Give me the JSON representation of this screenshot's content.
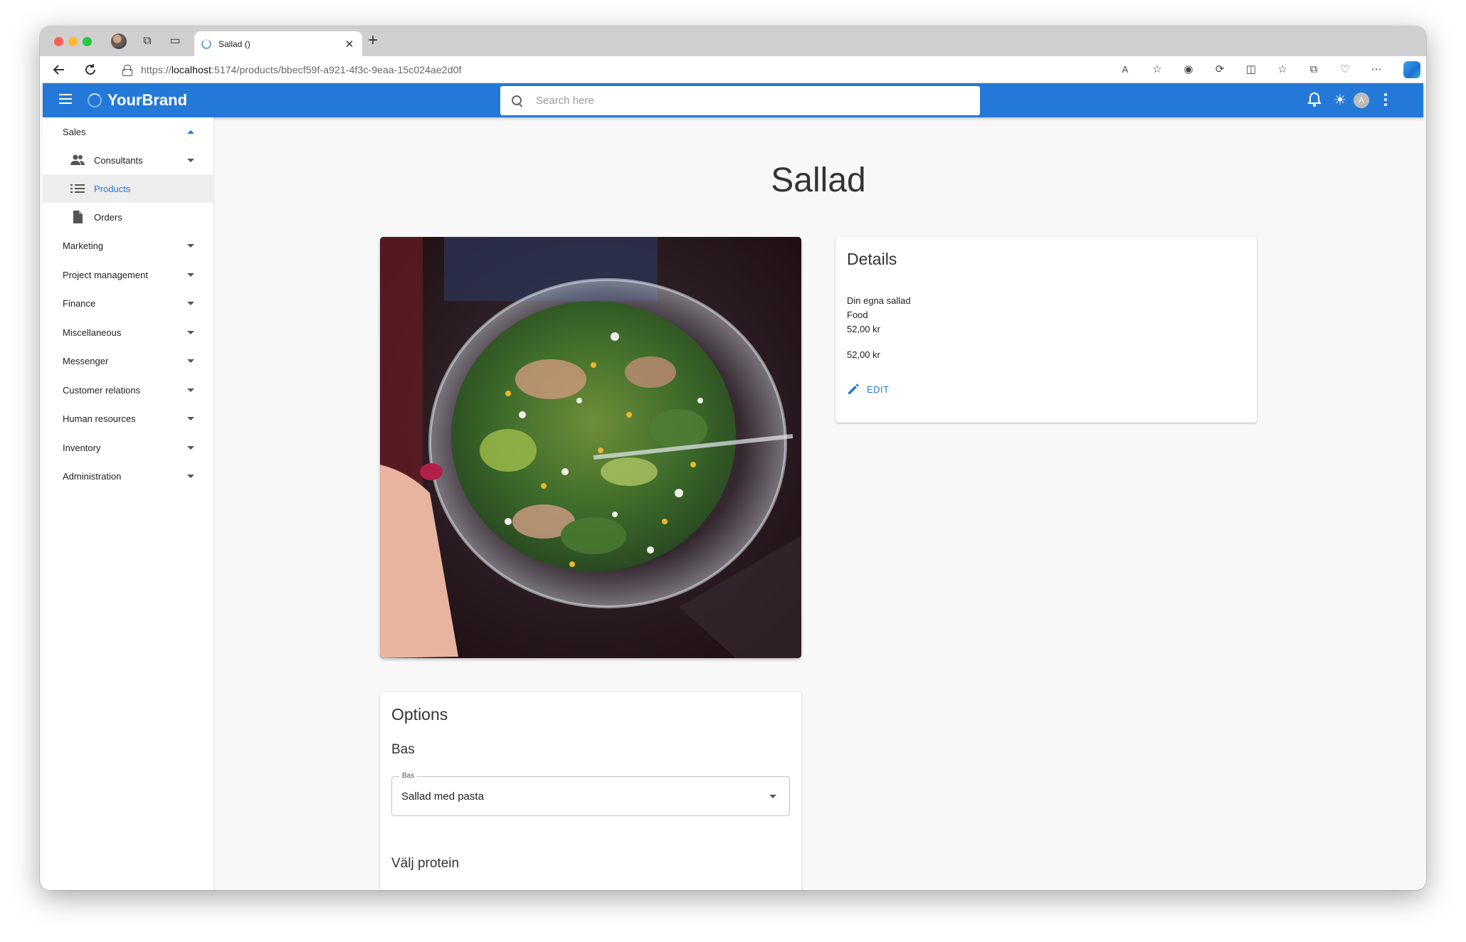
{
  "browser": {
    "tab_title": "Sallad ()",
    "url_prefix": "https://",
    "url_host": "localhost",
    "url_rest": ":5174/products/bbecf59f-a921-4f3c-9eaa-15c024ae2d0f"
  },
  "appbar": {
    "brand": "YourBrand",
    "search_placeholder": "Search here",
    "avatar_initial": "A"
  },
  "sidebar": {
    "items": [
      {
        "label": "Sales",
        "expanded": true
      },
      {
        "label": "Consultants",
        "sub": true,
        "icon": "people-icon"
      },
      {
        "label": "Products",
        "sub": true,
        "icon": "list-icon",
        "active": true
      },
      {
        "label": "Orders",
        "sub": true,
        "icon": "document-icon"
      },
      {
        "label": "Marketing"
      },
      {
        "label": "Project management"
      },
      {
        "label": "Finance"
      },
      {
        "label": "Miscellaneous"
      },
      {
        "label": "Messenger"
      },
      {
        "label": "Customer relations"
      },
      {
        "label": "Human resources"
      },
      {
        "label": "Inventory"
      },
      {
        "label": "Administration"
      }
    ]
  },
  "page": {
    "title": "Sallad"
  },
  "details": {
    "heading": "Details",
    "description": "Din egna sallad",
    "category": "Food",
    "price": "52,00 kr",
    "price2": "52,00 kr",
    "edit_label": "EDIT"
  },
  "options": {
    "heading": "Options",
    "group1_title": "Bas",
    "group1_select_label": "Bas",
    "group1_select_value": "Sallad med pasta",
    "group2_title": "Välj protein"
  },
  "colors": {
    "primary": "#2479d8",
    "background": "#f8f8f8"
  }
}
